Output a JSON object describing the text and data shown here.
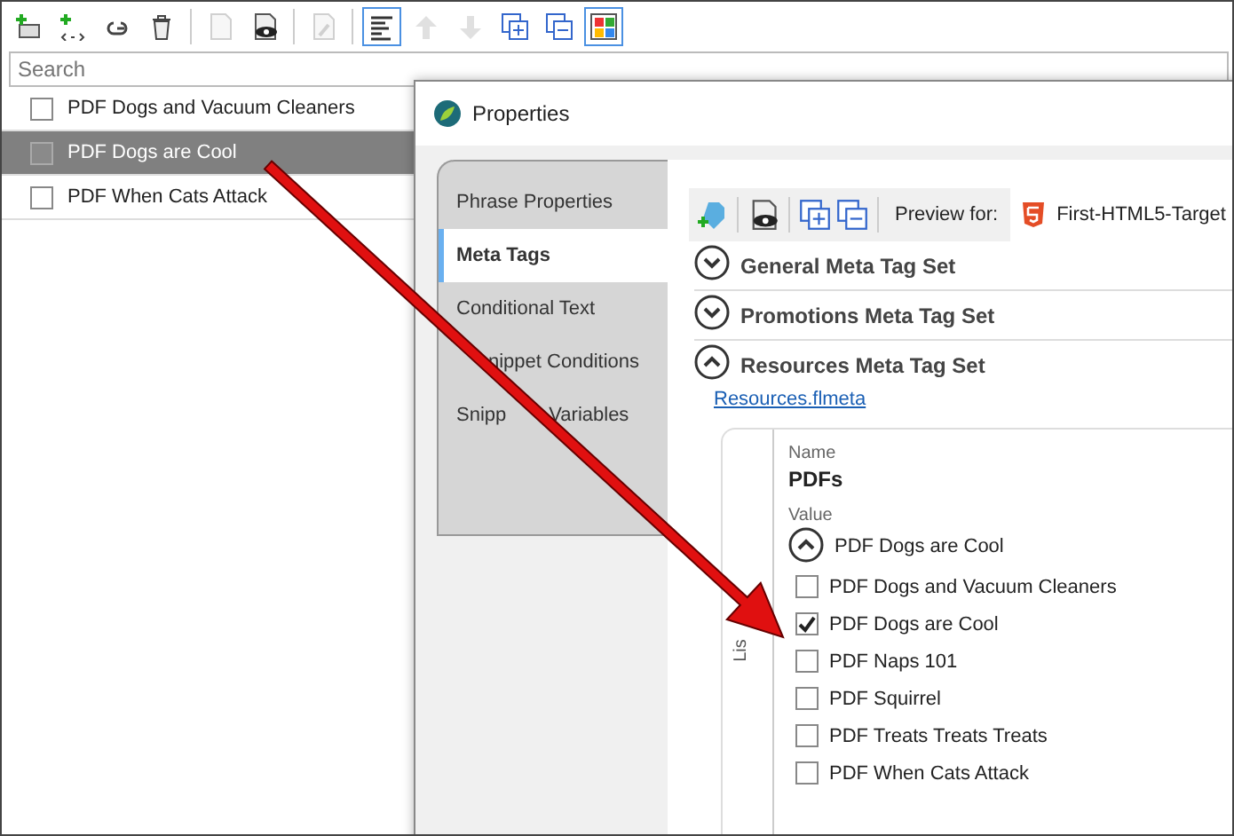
{
  "toolbar": [
    {
      "selected": false,
      "disabled": false
    },
    {
      "selected": false,
      "disabled": false
    },
    {
      "selected": false,
      "disabled": false
    },
    {
      "selected": false,
      "disabled": false
    },
    {
      "selected": false,
      "disabled": true
    },
    {
      "selected": false,
      "disabled": false
    },
    {
      "selected": false,
      "disabled": true
    },
    {
      "selected": true,
      "disabled": false
    },
    {
      "selected": false,
      "disabled": true
    },
    {
      "selected": false,
      "disabled": true
    },
    {
      "selected": false,
      "disabled": false
    },
    {
      "selected": false,
      "disabled": false
    },
    {
      "selected": true,
      "disabled": false
    }
  ],
  "search": {
    "placeholder": "Search"
  },
  "items": [
    {
      "label": "PDF Dogs and Vacuum Cleaners",
      "checked": false,
      "selected": false
    },
    {
      "label": "PDF Dogs are Cool",
      "checked": false,
      "selected": true
    },
    {
      "label": "PDF When Cats Attack",
      "checked": false,
      "selected": false
    }
  ],
  "dialog": {
    "title": "Properties",
    "tabs": [
      {
        "label": "Phrase Properties",
        "selected": false
      },
      {
        "label": "Meta Tags",
        "selected": true
      },
      {
        "label": "Conditional Text",
        "selected": false
      },
      {
        "label": "nippet Conditions",
        "selected": false
      },
      {
        "label": "Snipp",
        "label_after": "Variables",
        "selected": false
      }
    ],
    "preview_label": "Preview for:",
    "preview_target": "First-HTML5-Target",
    "sections": [
      {
        "title": "General Meta Tag Set",
        "expanded": false
      },
      {
        "title": "Promotions Meta Tag Set",
        "expanded": false
      },
      {
        "title": "Resources Meta Tag Set",
        "expanded": true
      }
    ],
    "link": "Resources.flmeta",
    "side_label": "Lis",
    "name_label": "Name",
    "name_value": "PDFs",
    "value_label": "Value",
    "value_text": "PDF Dogs are Cool",
    "value_expanded": true,
    "options": [
      {
        "label": "PDF Dogs and Vacuum Cleaners",
        "checked": false
      },
      {
        "label": "PDF Dogs are Cool",
        "checked": true
      },
      {
        "label": "PDF Naps 101",
        "checked": false
      },
      {
        "label": "PDF Squirrel",
        "checked": false
      },
      {
        "label": "PDF Treats Treats Treats",
        "checked": false
      },
      {
        "label": "PDF When Cats Attack",
        "checked": false
      }
    ]
  }
}
